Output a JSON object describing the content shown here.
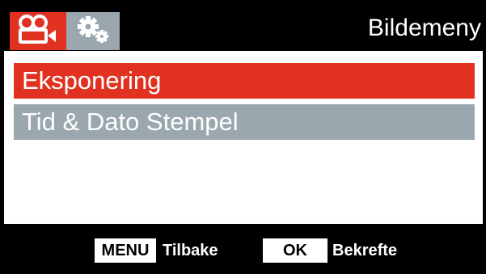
{
  "header": {
    "title": "Bildemeny",
    "tabs": [
      {
        "icon": "video-camera-icon",
        "active": true
      },
      {
        "icon": "gears-icon",
        "active": false
      }
    ]
  },
  "menu": {
    "items": [
      {
        "label": "Eksponering",
        "selected": true
      },
      {
        "label": "Tid & Dato Stempel",
        "selected": false
      }
    ]
  },
  "footer": {
    "menu_key": "MENU",
    "menu_action": "Tilbake",
    "ok_key": "OK",
    "ok_action": "Bekrefte"
  },
  "colors": {
    "accent": "#e03121",
    "inactive": "#9aa7ae",
    "background": "#000000",
    "panel": "#ffffff"
  }
}
